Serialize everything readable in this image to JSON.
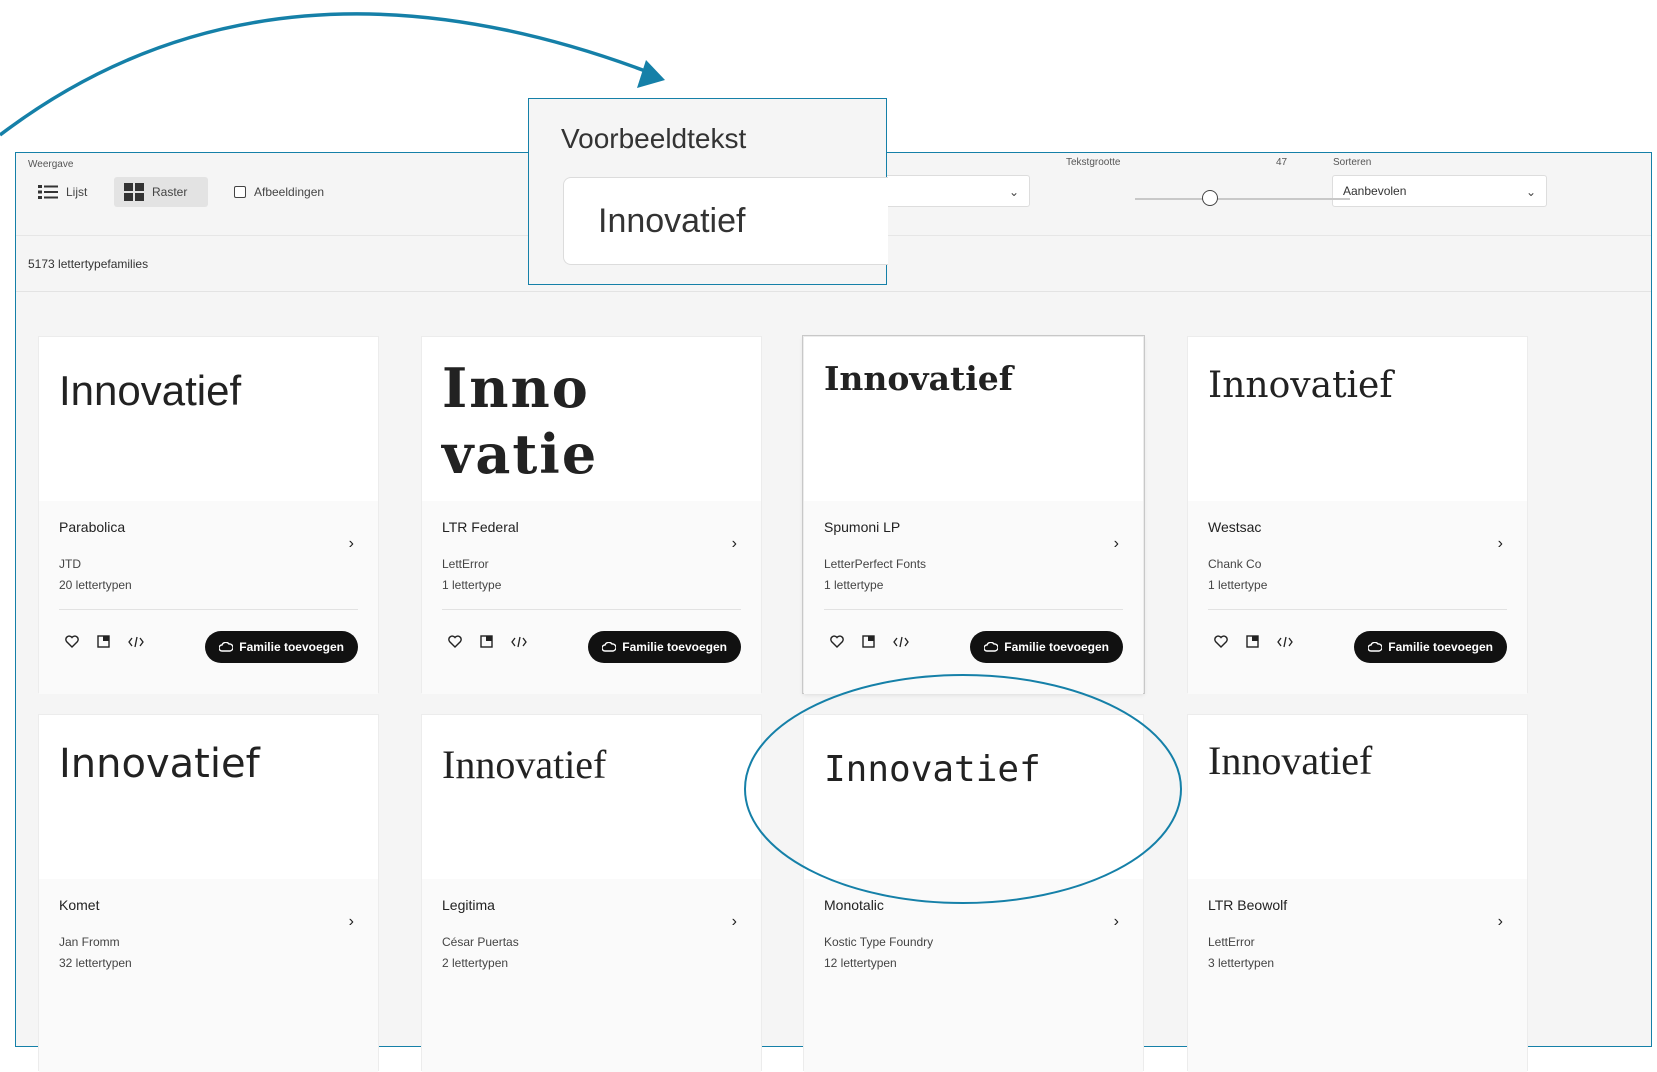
{
  "toolbar": {
    "view_label": "Weergave",
    "list_label": "Lijst",
    "grid_label": "Raster",
    "images_label": "Afbeeldingen",
    "text_size_label": "Tekstgrootte",
    "text_size_value": "47",
    "sort_label": "Sorteren",
    "sort_value": "Aanbevolen"
  },
  "count_text": "5173 lettertypefamilies",
  "sample_zoom": {
    "label": "Voorbeeldtekst",
    "value": "Innovatief"
  },
  "cards": [
    {
      "sample": "Innovatief",
      "name": "Parabolica",
      "foundry": "JTD",
      "count": "20 lettertypen",
      "button": "Familie toevoegen"
    },
    {
      "sample_line1": "Inno",
      "sample_line2": "vatie",
      "name": "LTR Federal",
      "foundry": "LettError",
      "count": "1 lettertype",
      "button": "Familie toevoegen"
    },
    {
      "sample": "Innovatief",
      "name": "Spumoni LP",
      "foundry": "LetterPerfect Fonts",
      "count": "1 lettertype",
      "button": "Familie toevoegen"
    },
    {
      "sample": "Innovatief",
      "name": "Westsac",
      "foundry": "Chank Co",
      "count": "1 lettertype",
      "button": "Familie toevoegen"
    },
    {
      "sample": "Innovatief",
      "name": "Komet",
      "foundry": "Jan Fromm",
      "count": "32 lettertypen"
    },
    {
      "sample": "Innovatief",
      "name": "Legitima",
      "foundry": "César Puertas",
      "count": "2 lettertypen"
    },
    {
      "sample": "Innovatief",
      "name": "Monotalic",
      "foundry": "Kostic Type Foundry",
      "count": "12 lettertypen"
    },
    {
      "sample": "Innovatief",
      "name": "LTR Beowolf",
      "foundry": "LettError",
      "count": "3 lettertypen"
    }
  ],
  "icons": [
    "list-icon",
    "grid-icon",
    "heart-icon",
    "copy-icon",
    "code-icon",
    "creative-cloud-icon",
    "chevron-right-icon",
    "chevron-down-icon"
  ],
  "colors": {
    "annotation": "#1580a8",
    "button": "#111111",
    "background": "#f5f5f5"
  }
}
